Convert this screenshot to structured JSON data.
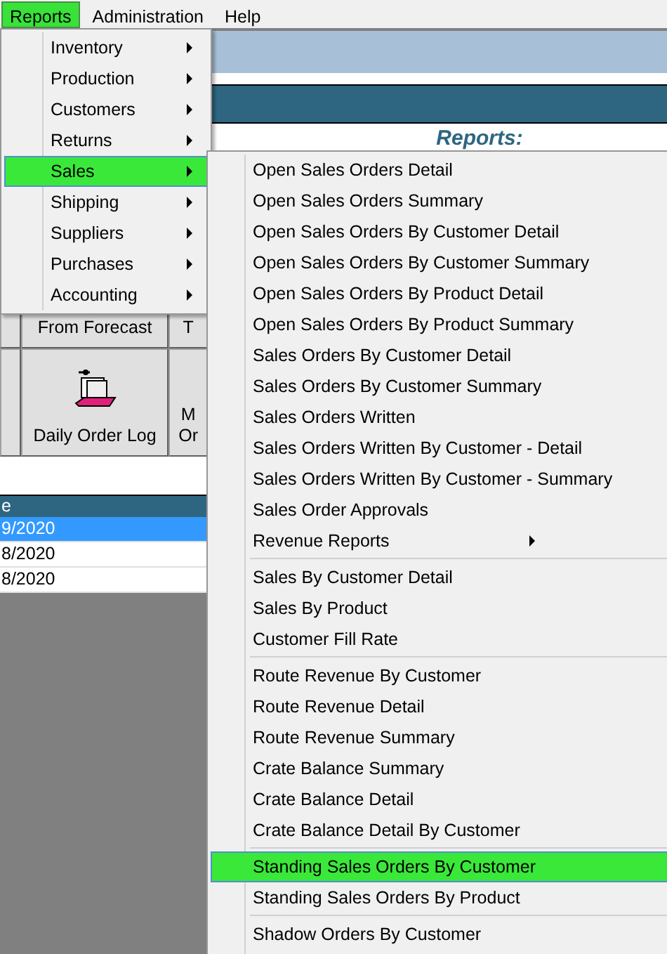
{
  "menu_bar": [
    {
      "label": "Reports",
      "selected": true
    },
    {
      "label": "Administration",
      "selected": false
    },
    {
      "label": "Help",
      "selected": false
    }
  ],
  "reports_heading": "Reports:",
  "toolbar_rows": [
    {
      "buttons": [
        {
          "kind": "text",
          "lines": [
            "From Forecast"
          ]
        },
        {
          "kind": "text",
          "lines": [
            "T"
          ]
        }
      ]
    },
    {
      "buttons": [
        {
          "kind": "icon",
          "lines": [
            "Daily Order Log"
          ]
        },
        {
          "kind": "text",
          "lines": [
            "M",
            "Or"
          ]
        }
      ]
    }
  ],
  "table": {
    "columns": [
      "e"
    ],
    "rows": [
      {
        "cells": [
          "9/2020"
        ],
        "selected": true
      },
      {
        "cells": [
          "8/2020"
        ],
        "selected": false
      },
      {
        "cells": [
          "8/2020"
        ],
        "selected": false
      }
    ]
  },
  "reports_menu": [
    {
      "label": "Inventory",
      "selected": false,
      "has_submenu": true
    },
    {
      "label": "Production",
      "selected": false,
      "has_submenu": true
    },
    {
      "label": "Customers",
      "selected": false,
      "has_submenu": true
    },
    {
      "label": "Returns",
      "selected": false,
      "has_submenu": true
    },
    {
      "label": "Sales",
      "selected": true,
      "has_submenu": true
    },
    {
      "label": "Shipping",
      "selected": false,
      "has_submenu": true
    },
    {
      "label": "Suppliers",
      "selected": false,
      "has_submenu": true
    },
    {
      "label": "Purchases",
      "selected": false,
      "has_submenu": true
    },
    {
      "label": "Accounting",
      "selected": false,
      "has_submenu": true
    }
  ],
  "sales_submenu": [
    [
      {
        "label": "Open Sales Orders Detail",
        "selected": false,
        "has_submenu": false
      },
      {
        "label": "Open Sales Orders Summary",
        "selected": false,
        "has_submenu": false
      },
      {
        "label": "Open Sales Orders By Customer Detail",
        "selected": false,
        "has_submenu": false
      },
      {
        "label": "Open Sales Orders By Customer Summary",
        "selected": false,
        "has_submenu": false
      },
      {
        "label": "Open Sales Orders By Product Detail",
        "selected": false,
        "has_submenu": false
      },
      {
        "label": "Open Sales Orders By Product Summary",
        "selected": false,
        "has_submenu": false
      },
      {
        "label": "Sales Orders By Customer Detail",
        "selected": false,
        "has_submenu": false
      },
      {
        "label": "Sales Orders By Customer Summary",
        "selected": false,
        "has_submenu": false
      },
      {
        "label": "Sales Orders Written",
        "selected": false,
        "has_submenu": false
      },
      {
        "label": "Sales Orders Written By Customer - Detail",
        "selected": false,
        "has_submenu": false
      },
      {
        "label": "Sales Orders Written By Customer - Summary",
        "selected": false,
        "has_submenu": false
      },
      {
        "label": "Sales Order Approvals",
        "selected": false,
        "has_submenu": false
      },
      {
        "label": "Revenue Reports",
        "selected": false,
        "has_submenu": true
      }
    ],
    [
      {
        "label": "Sales By Customer Detail",
        "selected": false,
        "has_submenu": false
      },
      {
        "label": "Sales By Product",
        "selected": false,
        "has_submenu": false
      },
      {
        "label": "Customer Fill Rate",
        "selected": false,
        "has_submenu": false
      }
    ],
    [
      {
        "label": "Route Revenue By Customer",
        "selected": false,
        "has_submenu": false
      },
      {
        "label": "Route Revenue Detail",
        "selected": false,
        "has_submenu": false
      },
      {
        "label": "Route Revenue Summary",
        "selected": false,
        "has_submenu": false
      },
      {
        "label": "Crate Balance Summary",
        "selected": false,
        "has_submenu": false
      },
      {
        "label": "Crate Balance Detail",
        "selected": false,
        "has_submenu": false
      },
      {
        "label": "Crate Balance Detail By Customer",
        "selected": false,
        "has_submenu": false
      }
    ],
    [
      {
        "label": "Standing Sales Orders By Customer",
        "selected": true,
        "has_submenu": false
      },
      {
        "label": "Standing Sales Orders By Product",
        "selected": false,
        "has_submenu": false
      }
    ],
    [
      {
        "label": "Shadow Orders By Customer",
        "selected": false,
        "has_submenu": false
      }
    ]
  ]
}
